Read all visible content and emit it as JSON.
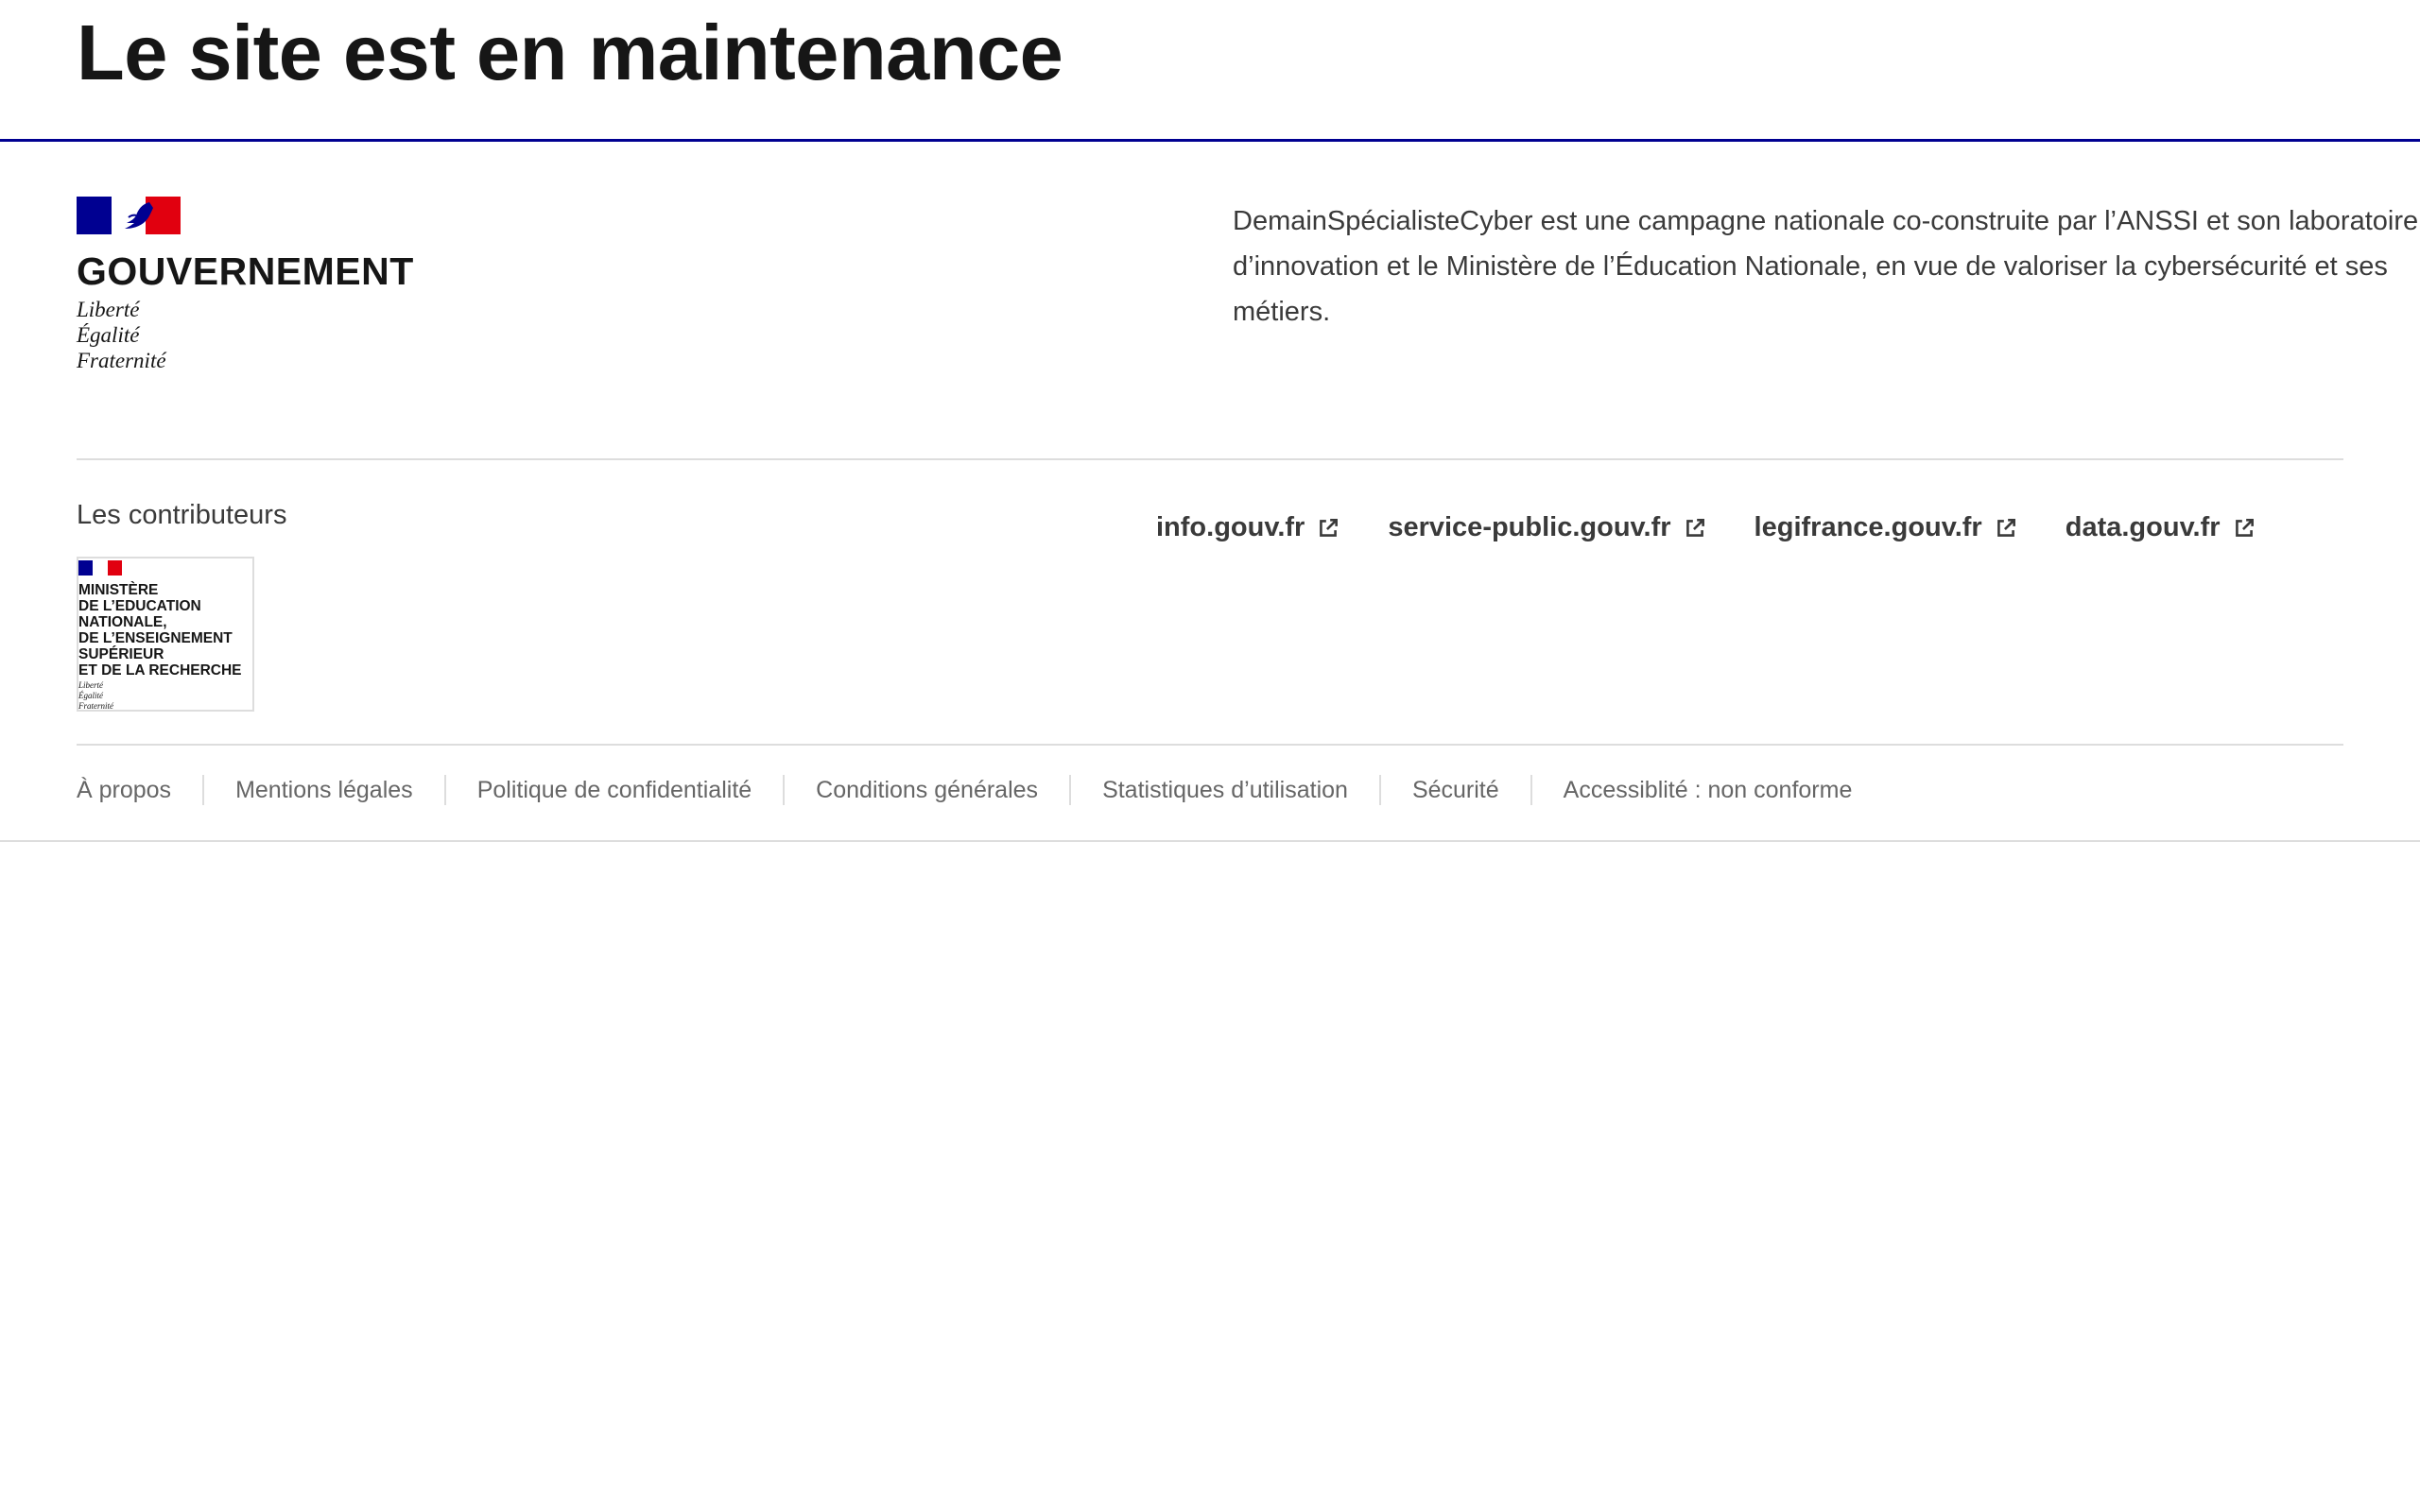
{
  "header": {
    "title": "Le site est en maintenance"
  },
  "footer": {
    "brand": {
      "name": "GOUVERNEMENT",
      "motto": [
        "Liberté",
        "Égalité",
        "Fraternité"
      ]
    },
    "description": "DemainSpécialisteCyber est une campagne nationale co-construite par l’ANSSI et son laboratoire d’innovation et le Ministère de l’Éducation Nationale, en vue de valoriser la cybersécurité et ses métiers.",
    "external_links": [
      {
        "label": "info.gouv.fr",
        "icon": "external-link-icon"
      },
      {
        "label": "service-public.gouv.fr",
        "icon": "external-link-icon"
      },
      {
        "label": "legifrance.gouv.fr",
        "icon": "external-link-icon"
      },
      {
        "label": "data.gouv.fr",
        "icon": "external-link-icon"
      }
    ],
    "partners": {
      "title": "Les contributeurs",
      "logo": {
        "name": "MINISTÈRE\nDE L’EDUCATION\nNATIONALE,\nDE L’ENSEIGNEMENT\nSUPÉRIEUR\nET DE LA RECHERCHE",
        "motto": [
          "Liberté",
          "Égalité",
          "Fraternité"
        ]
      }
    },
    "bottom_links": [
      "À propos",
      "Mentions légales",
      "Politique de confidentialité",
      "Conditions générales",
      "Statistiques d’utilisation",
      "Sécurité",
      "Accessiblité : non conforme"
    ]
  },
  "colors": {
    "brand_blue": "#000091",
    "brand_red": "#e1000f",
    "text": "#161616",
    "muted": "#666666",
    "border": "#dddddd"
  }
}
